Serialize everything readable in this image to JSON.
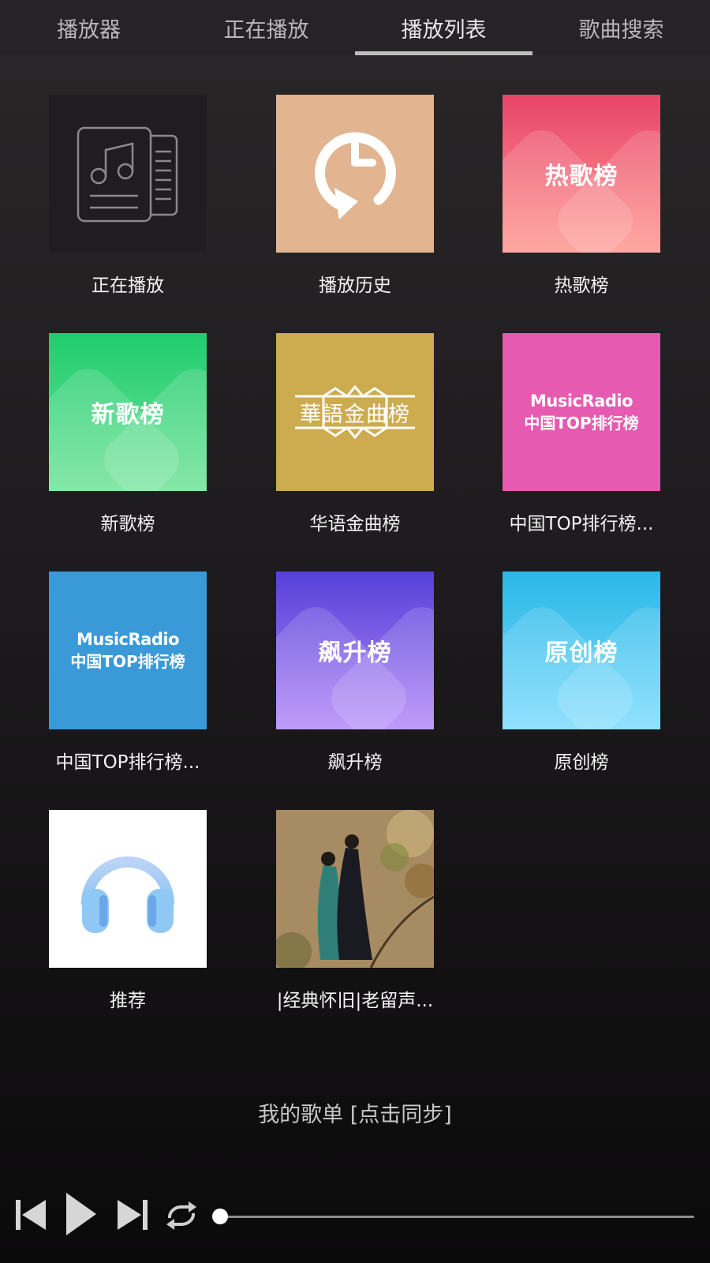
{
  "tabs": [
    "播放器",
    "正在播放",
    "播放列表",
    "歌曲搜索"
  ],
  "active_tab": 2,
  "playlists": [
    {
      "label": "正在播放",
      "cover_text": "",
      "icon": "music-document-icon",
      "color": "#1f1d1f"
    },
    {
      "label": "播放历史",
      "cover_text": "",
      "icon": "history-clock-icon",
      "color": "#e2b48f"
    },
    {
      "label": "热歌榜",
      "cover_text": "热歌榜",
      "icon": "",
      "color": "#f06070"
    },
    {
      "label": "新歌榜",
      "cover_text": "新歌榜",
      "icon": "",
      "color": "#3ed27a"
    },
    {
      "label": "华语金曲榜",
      "cover_text": "華語金曲榜",
      "icon": "",
      "color": "#cda94e"
    },
    {
      "label": "中国TOP排行榜...",
      "cover_text": "MusicRadio",
      "cover_text2": "中国TOP排行榜",
      "icon": "",
      "color": "#e65ab0"
    },
    {
      "label": "中国TOP排行榜...",
      "cover_text": "MusicRadio",
      "cover_text2": "中国TOP排行榜",
      "icon": "",
      "color": "#3a9ad8"
    },
    {
      "label": "飙升榜",
      "cover_text": "飙升榜",
      "icon": "",
      "color": "#7c5ef0"
    },
    {
      "label": "原创榜",
      "cover_text": "原创榜",
      "icon": "",
      "color": "#4cc7ee"
    },
    {
      "label": "推荐",
      "cover_text": "",
      "icon": "headphones-icon",
      "color": "#ffffff"
    },
    {
      "label": "|经典怀旧|老留声...",
      "cover_text": "",
      "icon": "couple-painting-image",
      "color": "#a48a60"
    }
  ],
  "my_playlists": "我的歌单 [点击同步]",
  "player": {
    "progress": 0
  }
}
